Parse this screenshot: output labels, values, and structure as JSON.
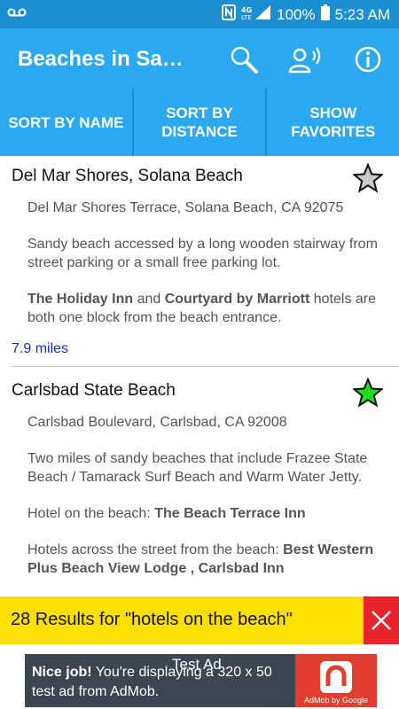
{
  "status": {
    "battery": "100%",
    "time": "5:23 AM",
    "network": "4G LTE"
  },
  "app_bar": {
    "title": "Beaches in San Diego"
  },
  "sort": {
    "by_name": "SORT BY NAME",
    "by_distance": "SORT BY DISTANCE",
    "show_favorites": "SHOW FAVORITES"
  },
  "results": [
    {
      "name": "Del Mar Shores, Solana Beach",
      "address": "Del Mar Shores Terrace, Solana Beach, CA 92075",
      "description": "Sandy beach accessed by a long wooden stairway from street parking or a small free parking lot.",
      "hotel_1": "The Holiday Inn",
      "hotel_and": " and ",
      "hotel_2": "Courtyard by Marriott",
      "hotel_tail": " hotels are both one block from the beach entrance.",
      "distance": "7.9 miles",
      "favorite": false
    },
    {
      "name": "Carlsbad State Beach",
      "address": "Carlsbad Boulevard, Carlsbad, CA 92008",
      "description": "Two miles of sandy beaches that include Frazee State Beach / Tamarack Surf Beach and Warm Water Jetty.",
      "hotel_on_label": "Hotel on the beach: ",
      "hotel_on": "The Beach Terrace Inn",
      "hotels_across_label": "Hotels across the street from the beach: ",
      "hotels_across": "Best Western Plus Beach View Lodge , Carlsbad Inn",
      "favorite": true
    }
  ],
  "results_banner": {
    "text": "28 Results for \"hotels on the beach\""
  },
  "ad": {
    "label": "Test Ad",
    "nice": "Nice job!",
    "message": " You're displaying a 320 x 50 test ad from AdMob.",
    "brand": "AdMob by Google"
  },
  "colors": {
    "status_bar": "#1a8fd2",
    "app_bar": "#2aa8f0",
    "results_banner": "#ffe000",
    "close": "#e8232c",
    "favorite_star": "#22dd22",
    "link": "#1530d8"
  }
}
